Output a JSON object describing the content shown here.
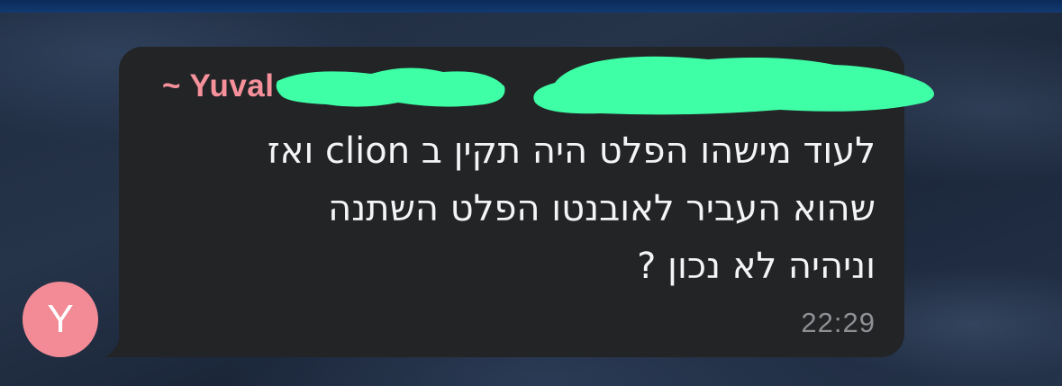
{
  "chat": {
    "message": {
      "sender_name": "~ Yuval",
      "lines": [
        "לעוד מישהו הפלט היה תקין ב clion ואז",
        "שהוא העביר לאובנטו הפלט השתנה",
        "וניהיה לא נכון ?"
      ],
      "time": "22:29"
    },
    "avatar": {
      "initial": "Y",
      "color": "#f28b95"
    }
  },
  "colors": {
    "bubble": "#222426",
    "sender_name": "#f6919b",
    "redaction": "#3effa6",
    "timestamp": "#8e9093"
  }
}
